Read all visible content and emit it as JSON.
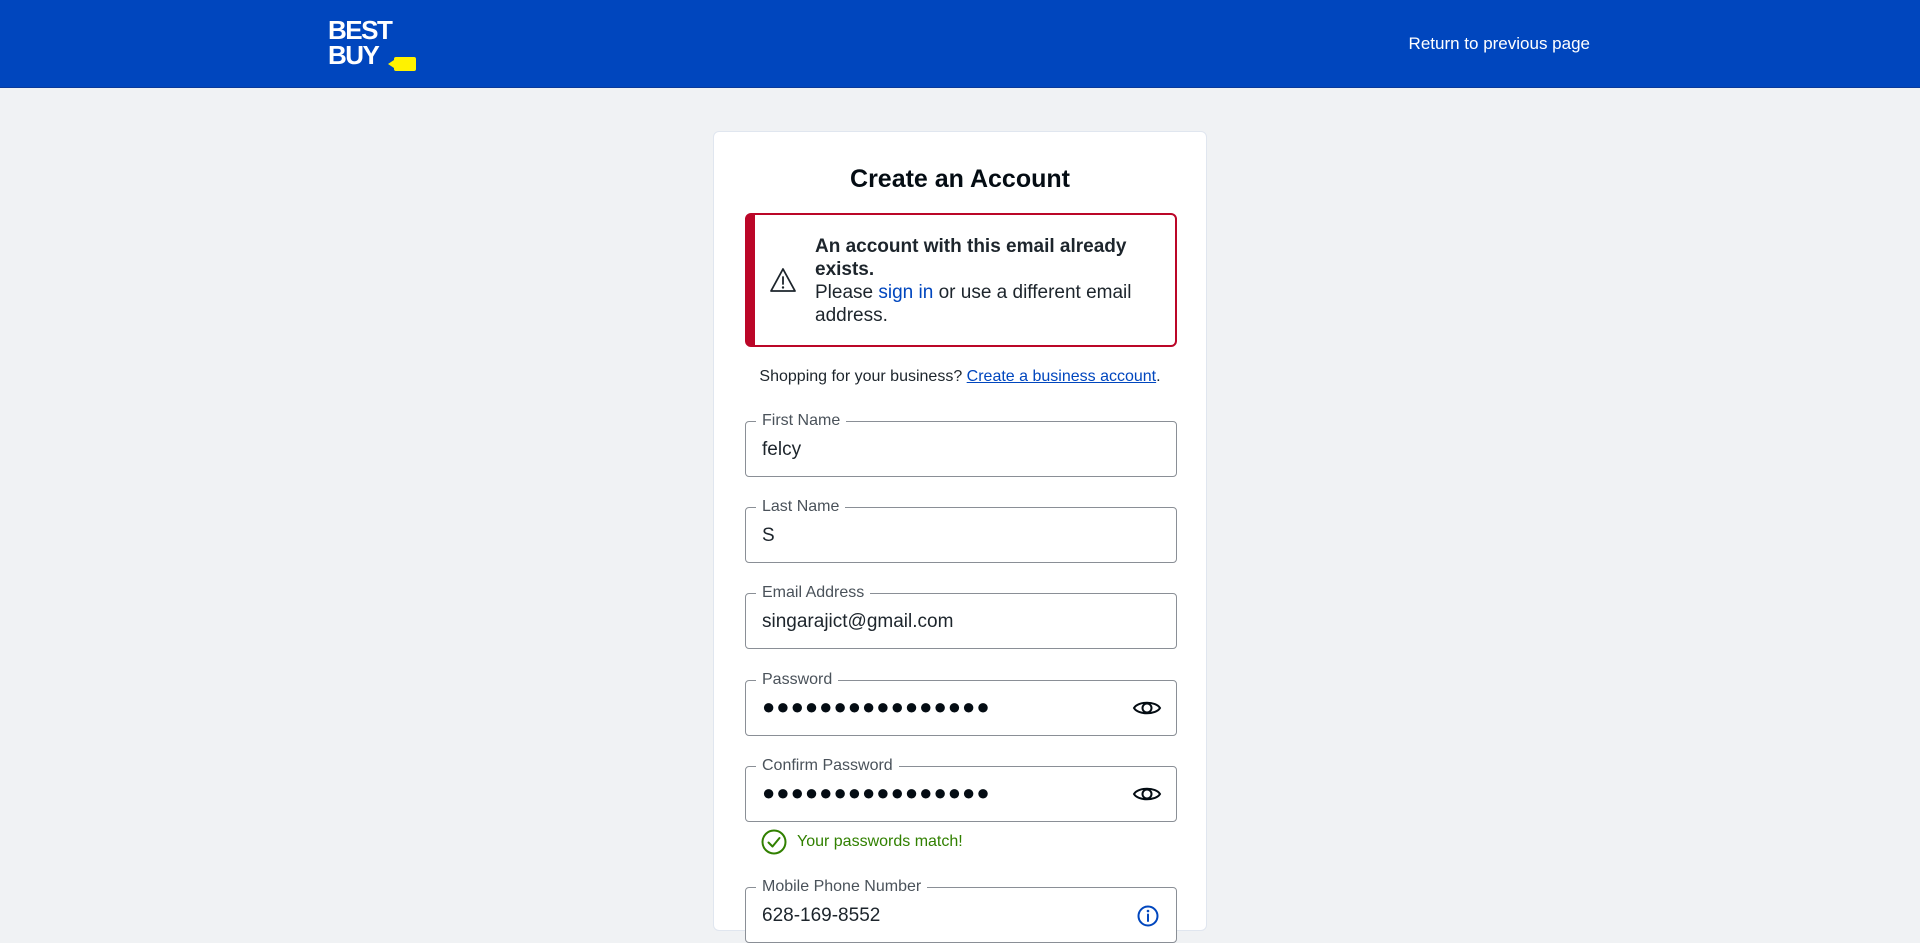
{
  "header": {
    "logo": {
      "line1": "BEST",
      "line2": "BUY"
    },
    "return_link": "Return to previous page",
    "brand_color": "#0046be",
    "tag_color": "#fff200"
  },
  "form": {
    "title": "Create an Account",
    "alert": {
      "headline": "An account with this email already exists.",
      "prefix": "Please ",
      "link": "sign in",
      "suffix": " or use a different email address.",
      "color": "#bb0628",
      "icon": "warning-icon"
    },
    "business": {
      "prompt": "Shopping for your business? ",
      "link": "Create a business account",
      "end": "."
    },
    "fields": {
      "first_name": {
        "label": "First Name",
        "value": "felcy"
      },
      "last_name": {
        "label": "Last Name",
        "value": "S"
      },
      "email": {
        "label": "Email Address",
        "value": "singarajict@gmail.com"
      },
      "password": {
        "label": "Password",
        "value": "●●●●●●●●●●●●●●●●",
        "icon": "eye-icon"
      },
      "confirm_password": {
        "label": "Confirm Password",
        "value": "●●●●●●●●●●●●●●●●",
        "icon": "eye-icon"
      },
      "phone": {
        "label": "Mobile Phone Number",
        "value": "628-169-8552",
        "icon": "info-icon"
      }
    },
    "password_match": {
      "message": "Your passwords match!",
      "color": "#318000",
      "icon": "check-circle-icon"
    }
  }
}
